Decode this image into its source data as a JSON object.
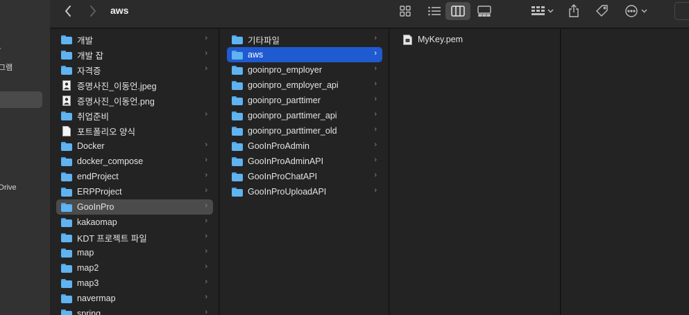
{
  "window": {
    "title": "aws"
  },
  "sidebar": {
    "fragments": [
      "그램",
      "Drive"
    ]
  },
  "toolbar": {
    "icons": [
      "chevron-left-icon",
      "chevron-right-icon",
      "grid-view-icon",
      "list-view-icon",
      "column-view-icon",
      "gallery-view-icon",
      "group-icon",
      "share-icon",
      "tag-icon",
      "more-icon",
      "search-icon"
    ]
  },
  "column1": [
    {
      "label": "개발",
      "type": "folder"
    },
    {
      "label": "개발 잡",
      "type": "folder"
    },
    {
      "label": "자격증",
      "type": "folder"
    },
    {
      "label": "증명사진_이동언.jpeg",
      "type": "image"
    },
    {
      "label": "증명사진_이동언.png",
      "type": "image"
    },
    {
      "label": "취업준비",
      "type": "folder"
    },
    {
      "label": "포트폴리오 양식",
      "type": "doc"
    },
    {
      "label": "Docker",
      "type": "folder"
    },
    {
      "label": "docker_compose",
      "type": "folder"
    },
    {
      "label": "endProject",
      "type": "folder"
    },
    {
      "label": "ERPProject",
      "type": "folder"
    },
    {
      "label": "GooInPro",
      "type": "folder",
      "selected": true
    },
    {
      "label": "kakaomap",
      "type": "folder"
    },
    {
      "label": "KDT 프로젝트 파일",
      "type": "folder"
    },
    {
      "label": "map",
      "type": "folder"
    },
    {
      "label": "map2",
      "type": "folder"
    },
    {
      "label": "map3",
      "type": "folder"
    },
    {
      "label": "navermap",
      "type": "folder"
    },
    {
      "label": "spring",
      "type": "folder"
    }
  ],
  "column2": [
    {
      "label": "기타파일",
      "type": "folder"
    },
    {
      "label": "aws",
      "type": "folder",
      "selected": true
    },
    {
      "label": "gooinpro_employer",
      "type": "folder"
    },
    {
      "label": "gooinpro_employer_api",
      "type": "folder"
    },
    {
      "label": "gooinpro_parttimer",
      "type": "folder"
    },
    {
      "label": "gooinpro_parttimer_api",
      "type": "folder"
    },
    {
      "label": "gooinpro_parttimer_old",
      "type": "folder"
    },
    {
      "label": "GooInProAdmin",
      "type": "folder"
    },
    {
      "label": "GooInProAdminAPI",
      "type": "folder"
    },
    {
      "label": "GooInProChatAPI",
      "type": "folder"
    },
    {
      "label": "GooInProUploadAPI",
      "type": "folder"
    }
  ],
  "column3": [
    {
      "label": "MyKey.pem",
      "type": "file"
    }
  ],
  "colors": {
    "selection_blue": "#1f5ad0",
    "folder": "#5fb3f0",
    "background": "#1e1e1e"
  }
}
